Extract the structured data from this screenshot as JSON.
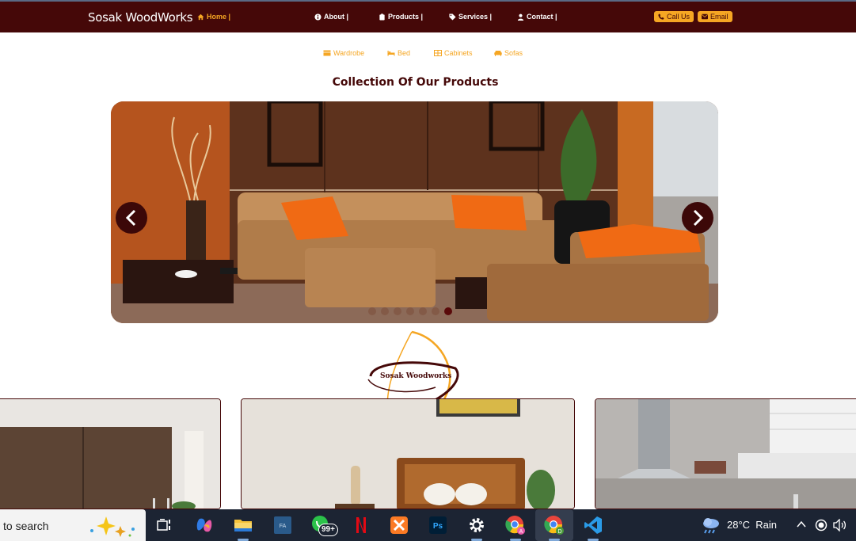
{
  "navbar": {
    "brand": "Sosak WoodWorks",
    "links": [
      {
        "label": "Home |",
        "icon": "home-icon",
        "active": true
      },
      {
        "label": "About |",
        "icon": "info-icon"
      },
      {
        "label": "Products |",
        "icon": "clipboard-icon"
      },
      {
        "label": "Services |",
        "icon": "tag-icon"
      },
      {
        "label": "Contact |",
        "icon": "user-icon"
      }
    ],
    "call_label": "Call Us",
    "email_label": "Email"
  },
  "subnav": [
    {
      "label": "Wardrobe",
      "icon": "wardrobe-icon"
    },
    {
      "label": "Bed",
      "icon": "bed-icon"
    },
    {
      "label": "Cabinets",
      "icon": "cabinet-icon"
    },
    {
      "label": "Sofas",
      "icon": "sofa-icon"
    }
  ],
  "section_title": "Collection Of Our Products",
  "carousel": {
    "slide_count": 7,
    "active_index": 6,
    "image": "living-room-sofa-photo"
  },
  "logo_text": "Sosak Woodworks",
  "cards": [
    "wardrobe-photo",
    "bed-photo",
    "kitchen-photo"
  ],
  "taskbar": {
    "search_text": "to search",
    "whatsapp_badge": "99+",
    "weather_temp": "28°C",
    "weather_desc": "Rain"
  },
  "colors": {
    "brand_maroon": "#450808",
    "accent_orange": "#f5a623",
    "taskbar": "#1c2433"
  }
}
